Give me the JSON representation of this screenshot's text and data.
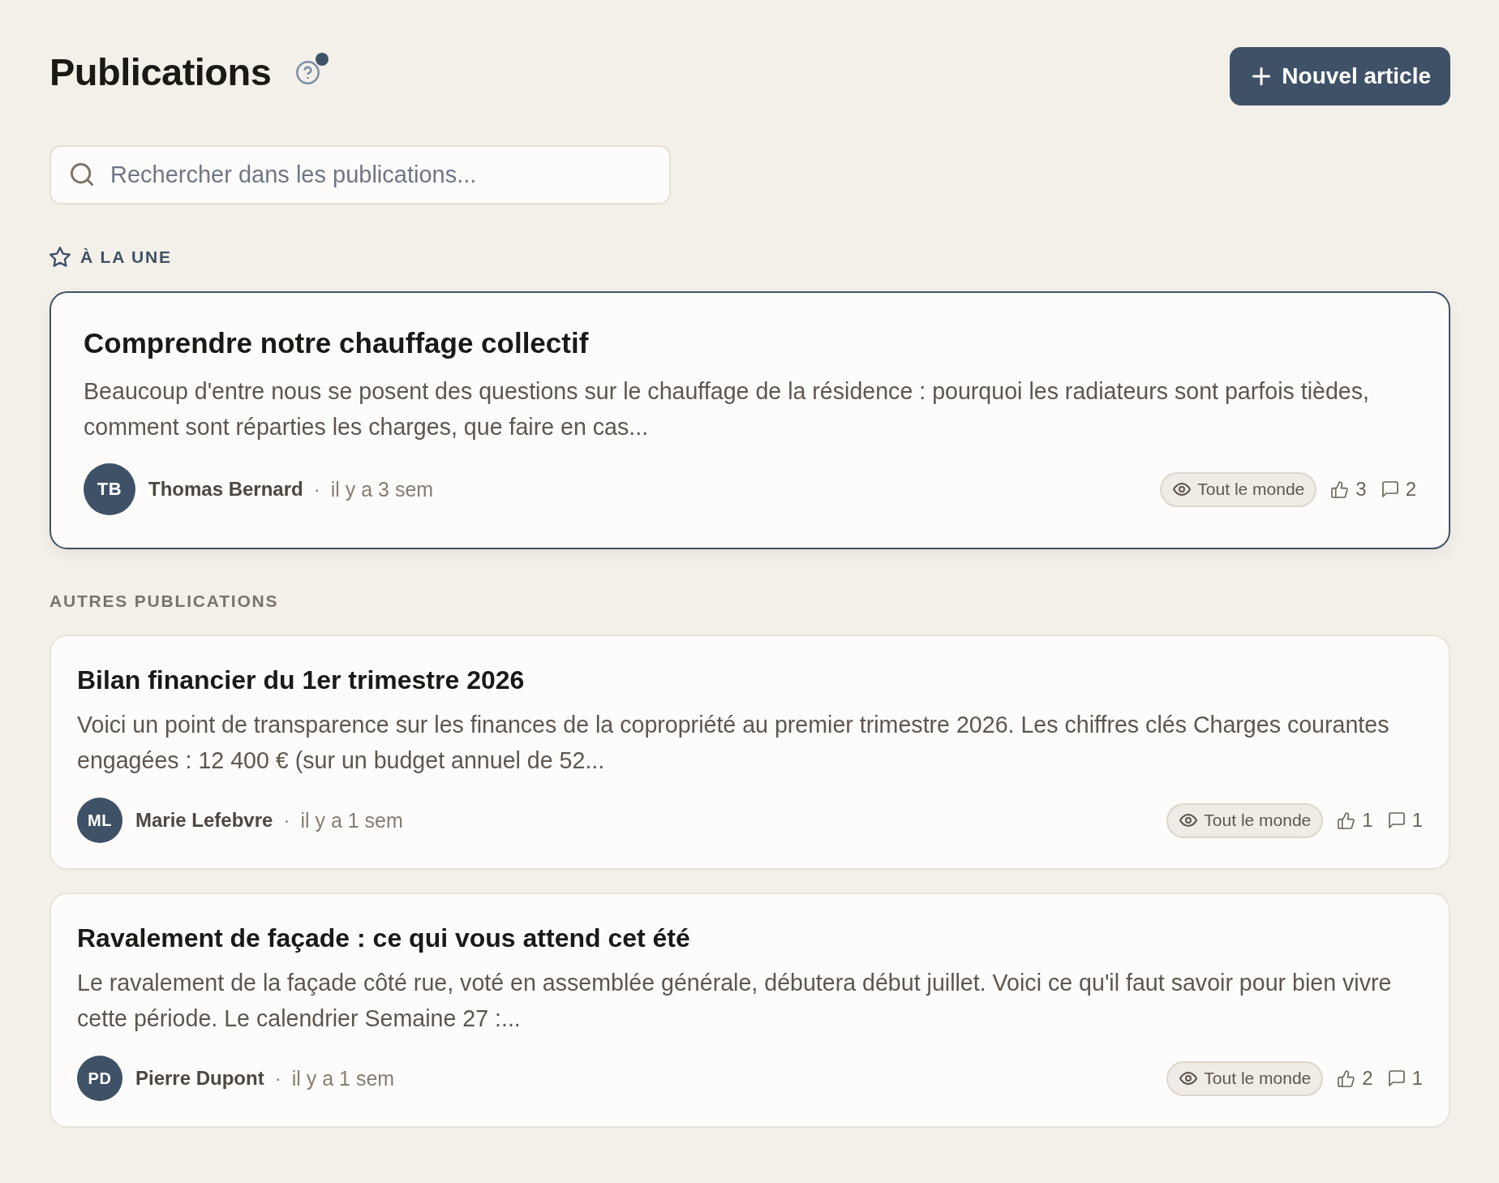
{
  "header": {
    "title": "Publications",
    "help": {
      "indicator": true
    },
    "new_button": {
      "label": "Nouvel article"
    }
  },
  "search": {
    "placeholder": "Rechercher dans les publications..."
  },
  "featured": {
    "heading": "À LA UNE",
    "post": {
      "title": "Comprendre notre chauffage collectif",
      "excerpt": "Beaucoup d'entre nous se posent des questions sur le chauffage de la résidence : pourquoi les radiateurs sont parfois tièdes, comment sont réparties les charges, que faire en cas...",
      "author": {
        "initials": "TB",
        "name": "Thomas Bernard"
      },
      "separator": "·",
      "time": "il y a 3 sem",
      "audience": "Tout le monde",
      "likes": "3",
      "comments": "2"
    }
  },
  "others": {
    "heading": "AUTRES PUBLICATIONS",
    "posts": [
      {
        "title": "Bilan financier du 1er trimestre 2026",
        "excerpt": "Voici un point de transparence sur les finances de la copropriété au premier trimestre 2026. Les chiffres clés Charges courantes engagées : 12 400 € (sur un budget annuel de 52...",
        "author": {
          "initials": "ML",
          "name": "Marie Lefebvre"
        },
        "separator": "·",
        "time": "il y a 1 sem",
        "audience": "Tout le monde",
        "likes": "1",
        "comments": "1"
      },
      {
        "title": "Ravalement de façade : ce qui vous attend cet été",
        "excerpt": "Le ravalement de la façade côté rue, voté en assemblée générale, débutera début juillet. Voici ce qu'il faut savoir pour bien vivre cette période. Le calendrier Semaine 27 :...",
        "author": {
          "initials": "PD",
          "name": "Pierre Dupont"
        },
        "separator": "·",
        "time": "il y a 1 sem",
        "audience": "Tout le monde",
        "likes": "2",
        "comments": "1"
      }
    ]
  }
}
